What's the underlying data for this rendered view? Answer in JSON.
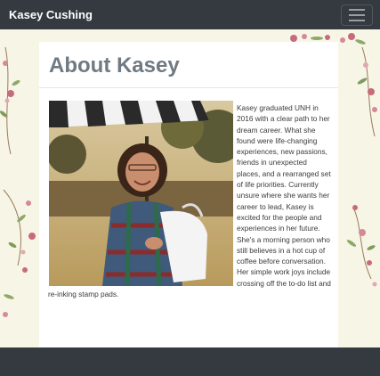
{
  "navbar": {
    "brand": "Kasey Cushing",
    "menu_icon": "hamburger-menu-icon"
  },
  "page": {
    "title": "About Kasey",
    "photo_alt": "Kasey smiling outdoors under a striped awning",
    "bio": "Kasey graduated UNH in 2016 with a clear path to her dream career. What she found were life-changing experiences, new passions, friends in unexpected places, and a rearranged set of life priorities. Currently unsure where she wants her career to lead, Kasey is excited for the people and experiences in her future. She's a morning person who still believes in a hot cup of coffee before conversation. Her simple work joys include crossing off the to-do list and re-inking stamp pads."
  },
  "colors": {
    "navbar": "#343a40",
    "background": "#f7f5e6",
    "title": "#707a83",
    "flower": "#c76b7c",
    "leaf": "#7f9a5a"
  }
}
